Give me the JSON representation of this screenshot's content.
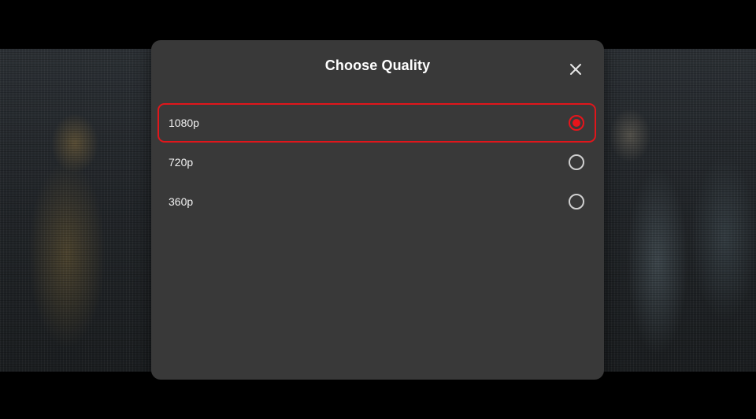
{
  "dialog": {
    "title": "Choose Quality",
    "close_icon": "close-icon"
  },
  "quality_options": [
    {
      "label": "1080p",
      "selected": true,
      "focused": true
    },
    {
      "label": "720p",
      "selected": false,
      "focused": false
    },
    {
      "label": "360p",
      "selected": false,
      "focused": false
    }
  ],
  "colors": {
    "accent": "#e8141b",
    "dialog_bg": "#393939",
    "text": "#ffffff"
  }
}
